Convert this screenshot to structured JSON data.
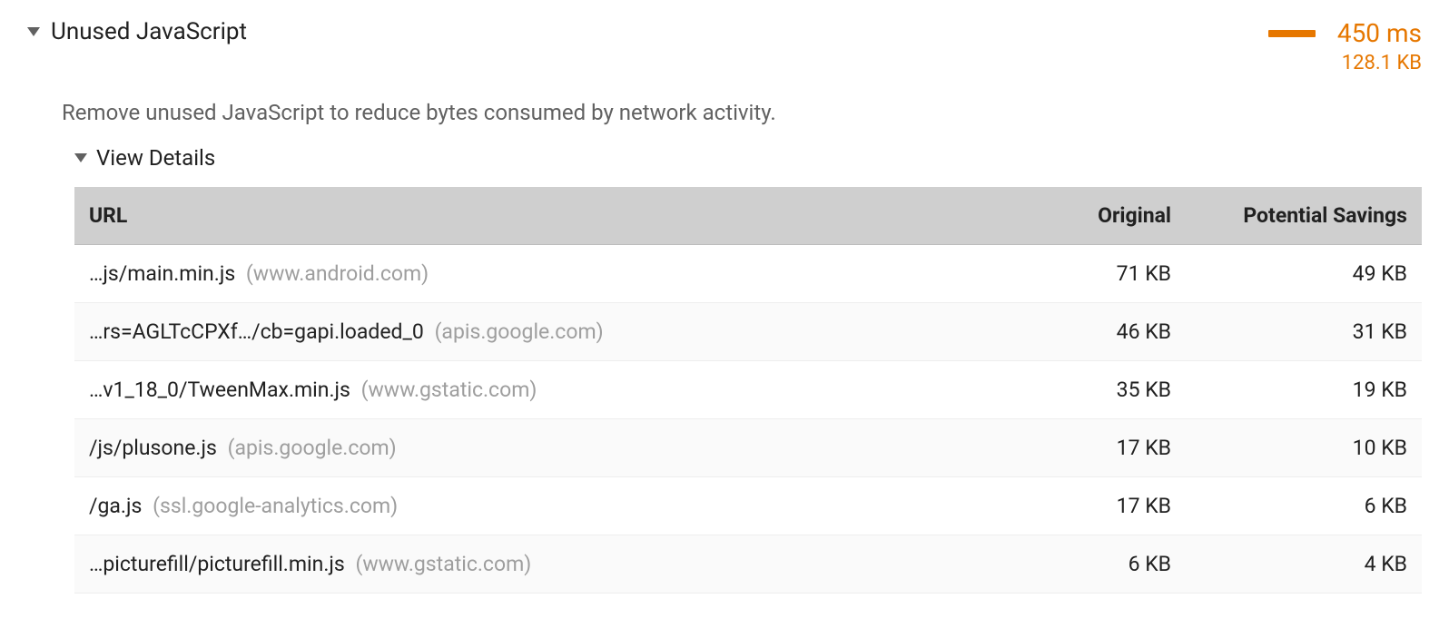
{
  "audit": {
    "title": "Unused JavaScript",
    "time_metric": "450 ms",
    "size_metric": "128.1 KB",
    "description": "Remove unused JavaScript to reduce bytes consumed by network activity.",
    "details_label": "View Details"
  },
  "table": {
    "headers": {
      "url": "URL",
      "original": "Original",
      "savings": "Potential Savings"
    },
    "rows": [
      {
        "path": "…js/main.min.js",
        "host": "(www.android.com)",
        "original": "71 KB",
        "savings": "49 KB"
      },
      {
        "path": "…rs=AGLTcCPXf…/cb=gapi.loaded_0",
        "host": "(apis.google.com)",
        "original": "46 KB",
        "savings": "31 KB"
      },
      {
        "path": "…v1_18_0/TweenMax.min.js",
        "host": "(www.gstatic.com)",
        "original": "35 KB",
        "savings": "19 KB"
      },
      {
        "path": "/js/plusone.js",
        "host": "(apis.google.com)",
        "original": "17 KB",
        "savings": "10 KB"
      },
      {
        "path": "/ga.js",
        "host": "(ssl.google-analytics.com)",
        "original": "17 KB",
        "savings": "6 KB"
      },
      {
        "path": "…picturefill/picturefill.min.js",
        "host": "(www.gstatic.com)",
        "original": "6 KB",
        "savings": "4 KB"
      }
    ]
  }
}
